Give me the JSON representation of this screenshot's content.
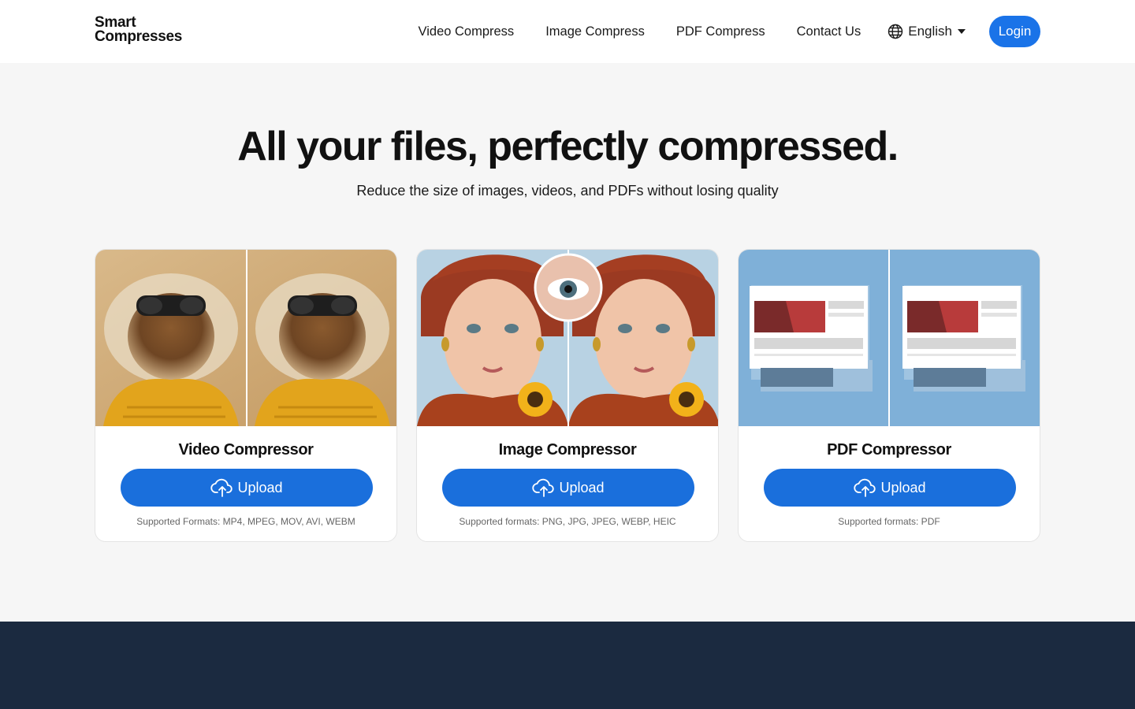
{
  "header": {
    "logo_line1": "Smart",
    "logo_line2": "Compresses",
    "nav": [
      "Video Compress",
      "Image Compress",
      "PDF Compress",
      "Contact Us"
    ],
    "language": "English",
    "login_label": "Login"
  },
  "hero": {
    "title": "All your files, perfectly compressed.",
    "subtitle": "Reduce the size of images, videos, and PDFs without losing quality"
  },
  "cards": [
    {
      "title": "Video Compressor",
      "button": "Upload",
      "formats": "Supported Formats: MP4, MPEG, MOV, AVI, WEBM"
    },
    {
      "title": "Image Compressor",
      "button": "Upload",
      "formats": "Supported formats: PNG, JPG, JPEG, WEBP, HEIC"
    },
    {
      "title": "PDF Compressor",
      "button": "Upload",
      "formats": "Supported formats: PDF"
    }
  ],
  "colors": {
    "accent": "#1a73e8",
    "footer": "#1b2a40",
    "background": "#f6f6f6"
  }
}
